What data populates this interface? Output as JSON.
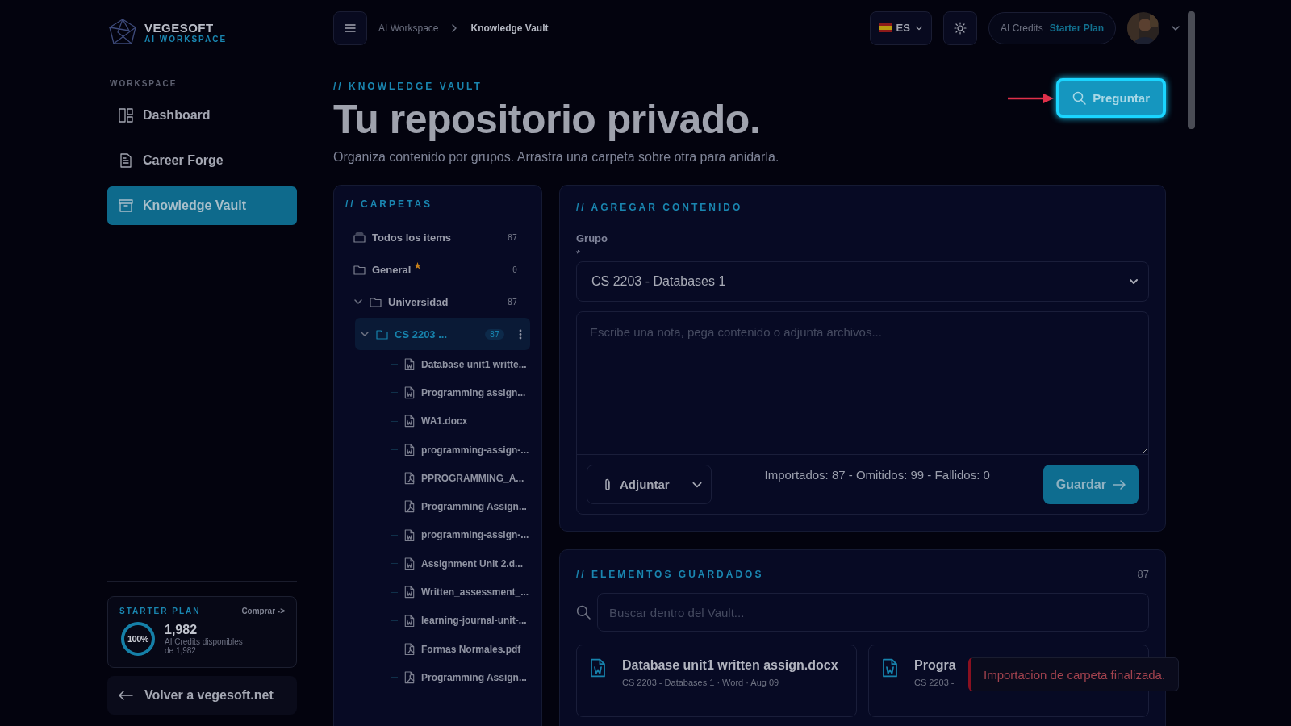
{
  "sidebar": {
    "brand": "VEGESOFT",
    "brand_sub": "AI WORKSPACE",
    "section": "WORKSPACE",
    "items": [
      {
        "label": "Dashboard",
        "kind": "dashboard",
        "selected": false
      },
      {
        "label": "Career Forge",
        "kind": "document",
        "selected": false
      },
      {
        "label": "Knowledge Vault",
        "kind": "archive",
        "selected": true
      }
    ],
    "plan": {
      "title": "STARTER PLAN",
      "action": "Comprar ->",
      "percent": "100%",
      "level": 1,
      "credits": "1,982",
      "description": "AI Credits disponibles",
      "total": "de 1,982"
    },
    "back_link": "Volver a vegesoft.net"
  },
  "header": {
    "breadcrumb": [
      "AI Workspace",
      "Knowledge Vault"
    ],
    "language": "ES",
    "credits_label": "AI Credits",
    "plan": "Starter Plan"
  },
  "page": {
    "eyebrow": "// KNOWLEDGE VAULT",
    "title": "Tu repositorio privado.",
    "subtitle": "Organiza contenido por grupos. Arrastra una carpeta sobre otra para anidarla.",
    "ask_button": "Preguntar"
  },
  "folders": {
    "title": "// CARPETAS",
    "items": [
      {
        "kind": "all",
        "label": "Todos los items",
        "count": "87",
        "selected": false,
        "starred": false
      },
      {
        "kind": "folder",
        "label": "General",
        "count": "0",
        "selected": false,
        "starred": true
      },
      {
        "kind": "folder",
        "label": "Universidad",
        "count": "87",
        "selected": false,
        "starred": false,
        "expanded": true,
        "children": [
          {
            "kind": "folder",
            "label": "CS 2203 ...",
            "count": "87",
            "selected": true,
            "starred": false,
            "expanded": true,
            "children": [
              {
                "kind": "word",
                "label": "Database unit1 writte...",
                "selected": false
              },
              {
                "kind": "word",
                "label": "Programming assign...",
                "selected": false
              },
              {
                "kind": "word",
                "label": "WA1.docx",
                "selected": false
              },
              {
                "kind": "word",
                "label": "programming-assign-...",
                "selected": false
              },
              {
                "kind": "pdf",
                "label": "PPROGRAMMING_A...",
                "selected": false
              },
              {
                "kind": "pdf",
                "label": "Programming Assign...",
                "selected": false
              },
              {
                "kind": "word",
                "label": "programming-assign-...",
                "selected": false
              },
              {
                "kind": "word",
                "label": "Assignment Unit 2.d...",
                "selected": false
              },
              {
                "kind": "word",
                "label": "Written_assessment_...",
                "selected": false
              },
              {
                "kind": "word",
                "label": "learning-journal-unit-...",
                "selected": false
              },
              {
                "kind": "pdf",
                "label": "Formas Normales.pdf",
                "selected": false
              },
              {
                "kind": "pdf",
                "label": "Programming Assign...",
                "selected": false
              }
            ]
          }
        ]
      }
    ]
  },
  "add_content": {
    "title": "// AGREGAR CONTENIDO",
    "group_label": "Grupo",
    "required_mark": "*",
    "group_value": "CS 2203 - Databases 1",
    "note_placeholder": "Escribe una nota, pega contenido o adjunta archivos...",
    "attach_button": "Adjuntar",
    "status": "Importados: 87 - Omitidos: 99 - Fallidos: 0",
    "save_button": "Guardar"
  },
  "saved": {
    "title": "// ELEMENTOS GUARDADOS",
    "count": "87",
    "search_placeholder": "Buscar dentro del Vault...",
    "cards": [
      {
        "kind": "word",
        "title": "Database unit1 written assign.docx",
        "meta": "CS 2203 - Databases 1 · Word · Aug 09"
      },
      {
        "kind": "word",
        "title": "Progra",
        "meta": "CS 2203 -"
      }
    ]
  },
  "toast": {
    "message": "Importacion de carpeta finalizada."
  }
}
